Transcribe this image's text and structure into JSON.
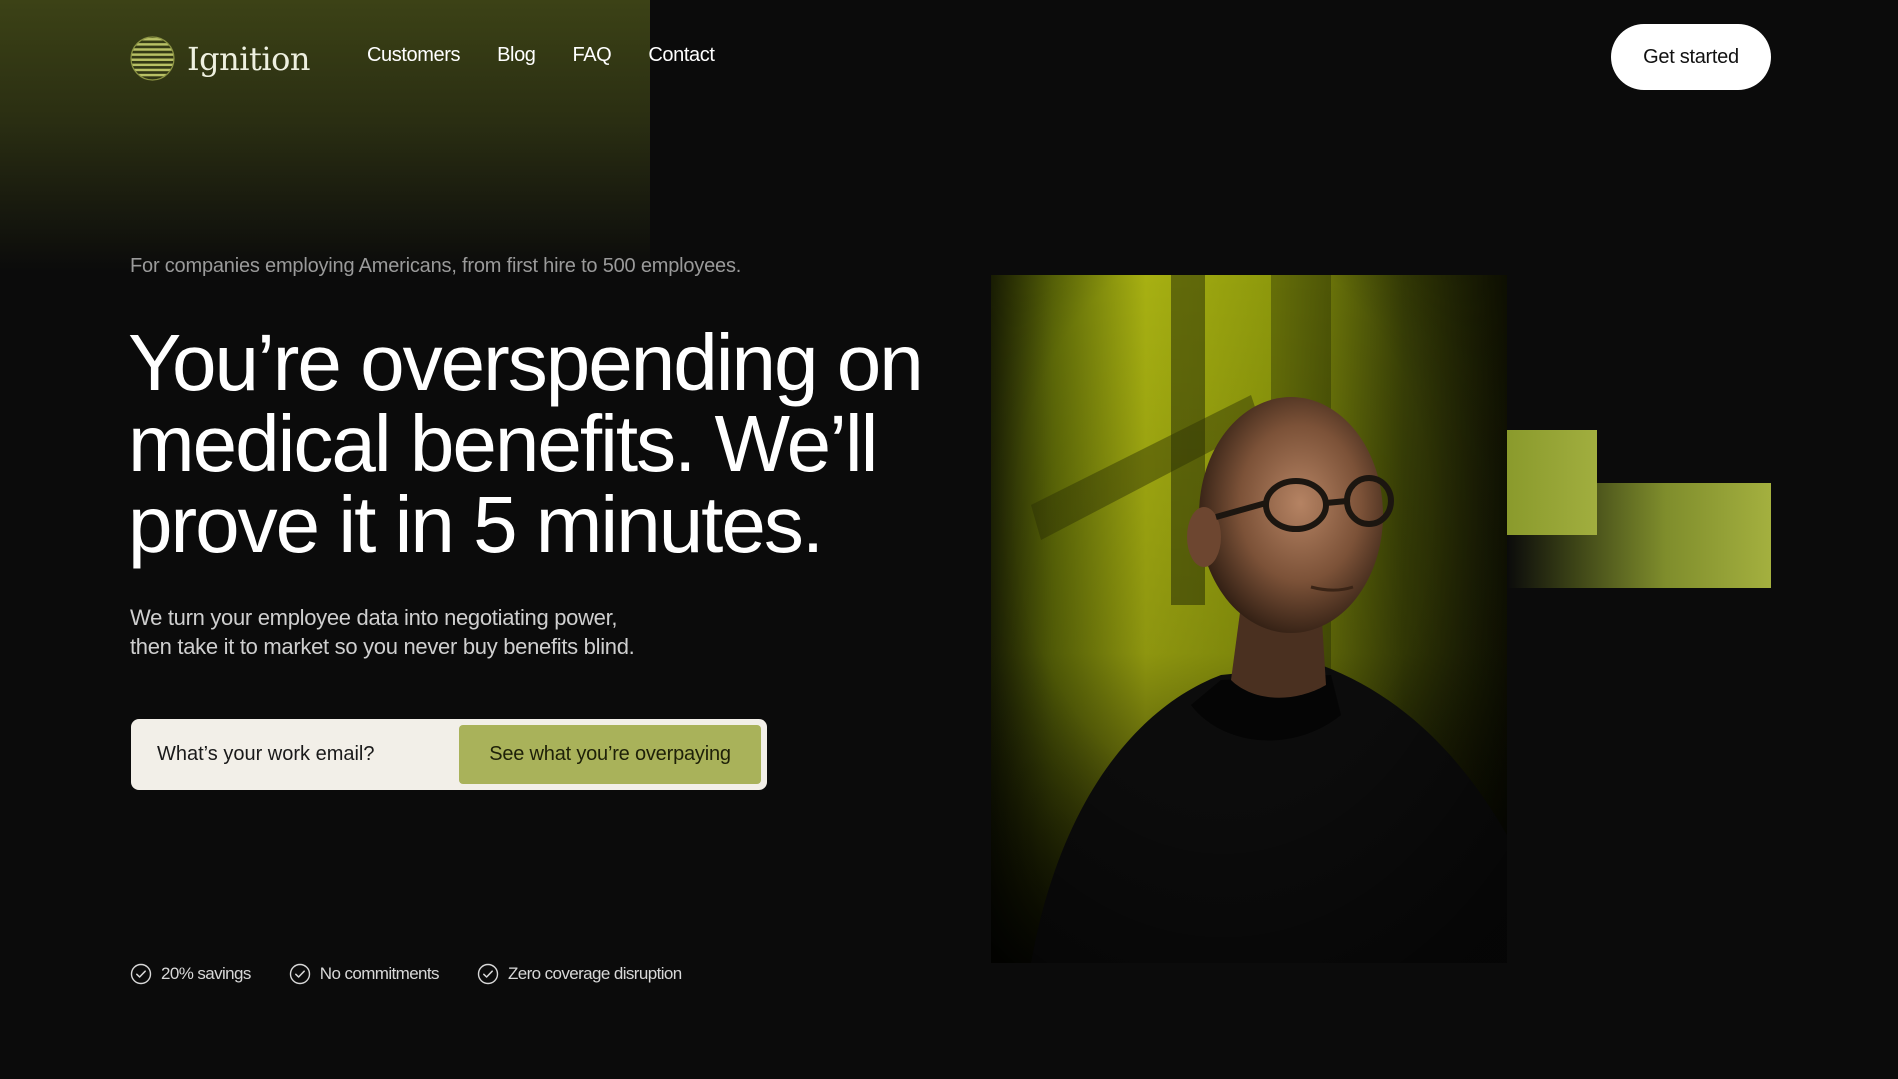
{
  "header": {
    "logo_text": "Ignition",
    "logo_icon": "striped-globe-icon",
    "nav": [
      {
        "label": "Customers"
      },
      {
        "label": "Blog"
      },
      {
        "label": "FAQ"
      },
      {
        "label": "Contact"
      }
    ],
    "cta_label": "Get started"
  },
  "hero": {
    "eyebrow": "For companies employing Americans, from first hire to 500 employees.",
    "headline_lines": [
      "You’re overspending on",
      "medical benefits. We’ll",
      "prove it in 5 minutes."
    ],
    "subhead_lines": [
      "We turn your employee data into negotiating power,",
      "then take it to market so you never buy benefits blind."
    ],
    "email_placeholder": "What’s your work email?",
    "submit_label": "See what you’re overpaying",
    "features": [
      {
        "icon": "check-circle-icon",
        "label": "20% savings"
      },
      {
        "icon": "check-circle-icon",
        "label": "No commitments"
      },
      {
        "icon": "check-circle-icon",
        "label": "Zero coverage disruption"
      }
    ]
  },
  "colors": {
    "background": "#0b0b0b",
    "accent": "#a9b25a",
    "form_bg": "#f2efe8",
    "glow": "#3c4216"
  }
}
